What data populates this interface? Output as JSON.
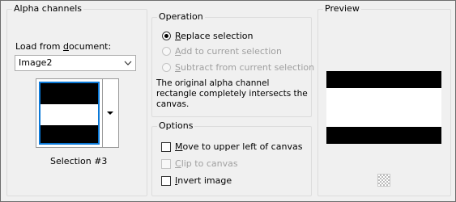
{
  "alpha_channels": {
    "title": "Alpha channels",
    "load_from_label_pre": "Load from ",
    "load_from_label_u": "d",
    "load_from_label_post": "ocument:",
    "document_selected": "Image2",
    "selection_caption": "Selection #3"
  },
  "operation": {
    "title": "Operation",
    "options": [
      {
        "u": "R",
        "rest": "eplace selection",
        "checked": true,
        "enabled": true
      },
      {
        "u": "A",
        "rest": "dd to current selection",
        "checked": false,
        "enabled": false
      },
      {
        "u": "S",
        "rest": "ubtract from current selection",
        "checked": false,
        "enabled": false
      }
    ],
    "description_line1": "The original alpha channel",
    "description_line2": "rectangle completely intersects the",
    "description_line3": "canvas."
  },
  "options": {
    "title": "Options",
    "move_u": "M",
    "move_rest": "ove to upper left of canvas",
    "move_checked": false,
    "clip_u": "C",
    "clip_rest": "lip to canvas",
    "clip_enabled": false,
    "invert_u": "I",
    "invert_rest": "nvert image",
    "invert_checked": false
  },
  "preview": {
    "title": "Preview"
  },
  "icons": {
    "dropdown": "chevron-down-icon",
    "selector": "caret-down-icon",
    "transparency": "checkerboard-icon"
  },
  "colors": {
    "accent": "#0a78d7",
    "disabled_text": "#a0a0a0"
  }
}
